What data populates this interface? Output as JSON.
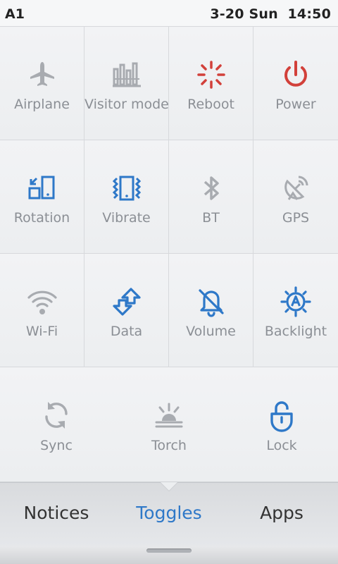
{
  "status_bar": {
    "carrier": "A1",
    "date": "3-20 Sun",
    "time": "14:50"
  },
  "colors": {
    "active_blue": "#2e78c8",
    "inactive_gray": "#a8abb0",
    "alert_red": "#d2403a",
    "label_gray": "#8b8f95"
  },
  "toggles": [
    {
      "label": "Airplane",
      "icon": "airplane-icon",
      "state": "off"
    },
    {
      "label": "Visitor mode",
      "icon": "visitor-mode-icon",
      "state": "off"
    },
    {
      "label": "Reboot",
      "icon": "reboot-icon",
      "state": "action"
    },
    {
      "label": "Power",
      "icon": "power-icon",
      "state": "action"
    },
    {
      "label": "Rotation",
      "icon": "rotation-icon",
      "state": "on"
    },
    {
      "label": "Vibrate",
      "icon": "vibrate-icon",
      "state": "on"
    },
    {
      "label": "BT",
      "icon": "bluetooth-icon",
      "state": "off"
    },
    {
      "label": "GPS",
      "icon": "gps-icon",
      "state": "off"
    },
    {
      "label": "Wi-Fi",
      "icon": "wifi-icon",
      "state": "off"
    },
    {
      "label": "Data",
      "icon": "data-icon",
      "state": "on"
    },
    {
      "label": "Volume",
      "icon": "volume-muted-icon",
      "state": "on"
    },
    {
      "label": "Backlight",
      "icon": "backlight-icon",
      "state": "on"
    }
  ],
  "bottom_toggles": [
    {
      "label": "Sync",
      "icon": "sync-icon",
      "state": "off"
    },
    {
      "label": "Torch",
      "icon": "torch-icon",
      "state": "off"
    },
    {
      "label": "Lock",
      "icon": "lock-icon",
      "state": "on"
    }
  ],
  "tabs": [
    {
      "label": "Notices",
      "selected": false
    },
    {
      "label": "Toggles",
      "selected": true
    },
    {
      "label": "Apps",
      "selected": false
    }
  ]
}
